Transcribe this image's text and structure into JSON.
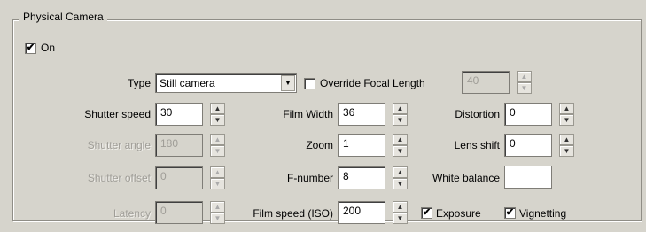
{
  "group": {
    "title": "Physical Camera"
  },
  "on": {
    "label": "On",
    "checked": true
  },
  "type": {
    "label": "Type",
    "value": "Still camera"
  },
  "override_focal": {
    "label": "Override Focal Length",
    "checked": false,
    "value": "40"
  },
  "col1": {
    "shutter_speed": {
      "label": "Shutter speed",
      "value": "30"
    },
    "shutter_angle": {
      "label": "Shutter angle",
      "value": "180"
    },
    "shutter_offset": {
      "label": "Shutter offset",
      "value": "0"
    },
    "latency": {
      "label": "Latency",
      "value": "0"
    }
  },
  "col2": {
    "film_width": {
      "label": "Film Width",
      "value": "36"
    },
    "zoom": {
      "label": "Zoom",
      "value": "1"
    },
    "f_number": {
      "label": "F-number",
      "value": "8"
    },
    "film_speed": {
      "label": "Film speed (ISO)",
      "value": "200"
    }
  },
  "col3": {
    "distortion": {
      "label": "Distortion",
      "value": "0"
    },
    "lens_shift": {
      "label": "Lens shift",
      "value": "0"
    },
    "white_balance": {
      "label": "White balance"
    },
    "exposure": {
      "label": "Exposure",
      "checked": true
    },
    "vignetting": {
      "label": "Vignetting",
      "checked": true
    }
  },
  "glyphs": {
    "check": "✔",
    "arrow_down": "▼",
    "spin_up": "▲",
    "spin_down": "▼"
  }
}
